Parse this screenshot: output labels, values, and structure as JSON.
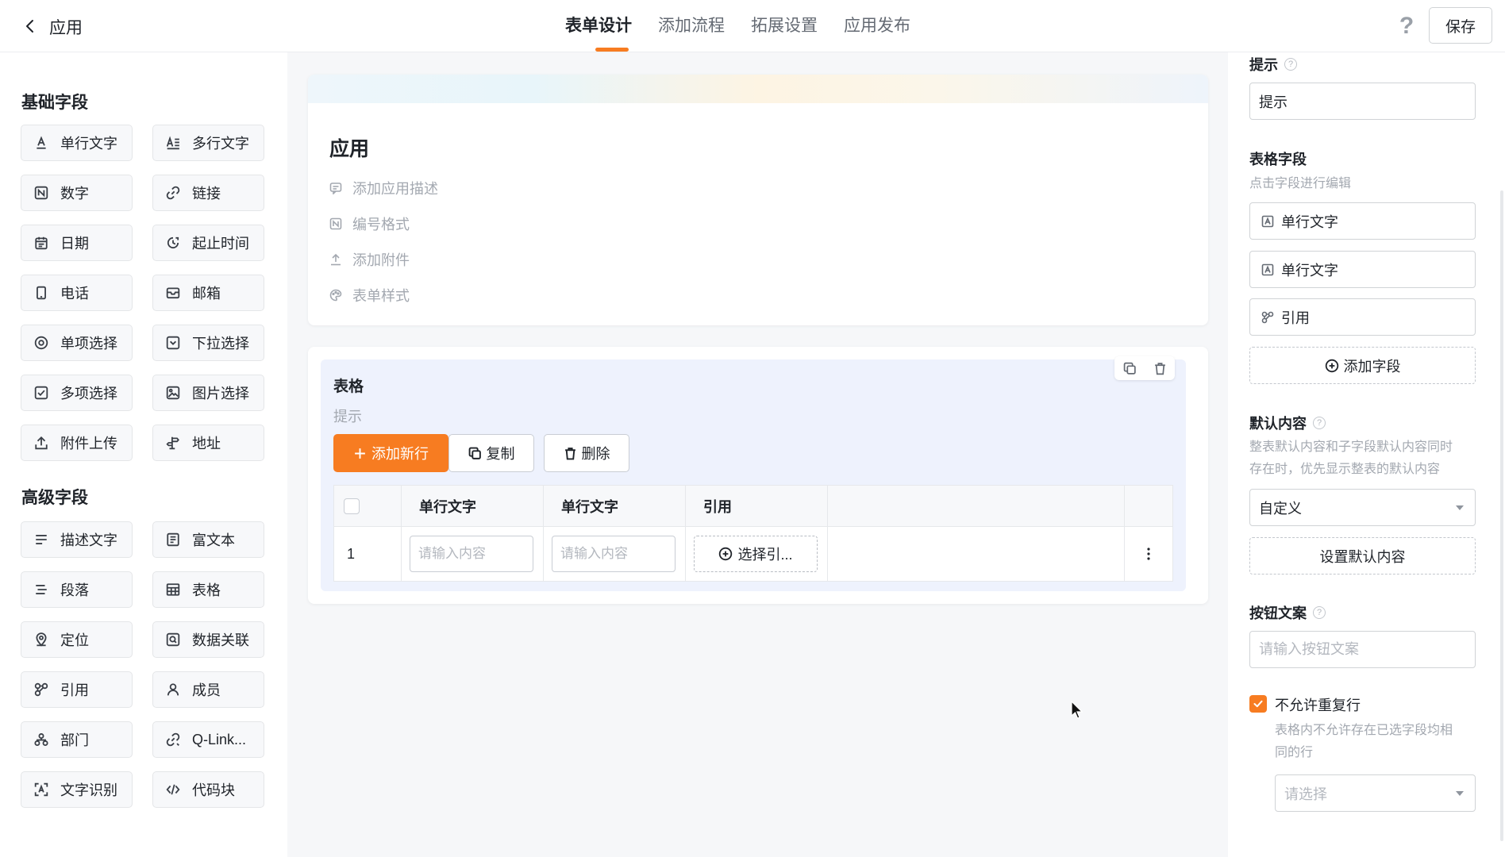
{
  "header": {
    "back_icon": "chevron-left-icon",
    "app_title": "应用",
    "tabs": [
      {
        "label": "表单设计",
        "active": true
      },
      {
        "label": "添加流程",
        "active": false
      },
      {
        "label": "拓展设置",
        "active": false
      },
      {
        "label": "应用发布",
        "active": false
      }
    ],
    "help_icon": "question-icon",
    "save_label": "保存",
    "accent_color": "#f77c21"
  },
  "left_panel": {
    "basic_title": "基础字段",
    "basic_fields": [
      {
        "label": "单行文字",
        "icon": "text-icon"
      },
      {
        "label": "多行文字",
        "icon": "multiline-text-icon"
      },
      {
        "label": "数字",
        "icon": "number-icon"
      },
      {
        "label": "链接",
        "icon": "link-icon"
      },
      {
        "label": "日期",
        "icon": "calendar-icon"
      },
      {
        "label": "起止时间",
        "icon": "time-range-icon"
      },
      {
        "label": "电话",
        "icon": "phone-icon"
      },
      {
        "label": "邮箱",
        "icon": "mail-icon"
      },
      {
        "label": "单项选择",
        "icon": "radio-icon"
      },
      {
        "label": "下拉选择",
        "icon": "dropdown-icon"
      },
      {
        "label": "多项选择",
        "icon": "checkbox-icon"
      },
      {
        "label": "图片选择",
        "icon": "image-icon"
      },
      {
        "label": "附件上传",
        "icon": "upload-icon"
      },
      {
        "label": "地址",
        "icon": "signpost-icon"
      }
    ],
    "advanced_title": "高级字段",
    "advanced_fields": [
      {
        "label": "描述文字",
        "icon": "description-icon"
      },
      {
        "label": "富文本",
        "icon": "rich-text-icon"
      },
      {
        "label": "段落",
        "icon": "paragraph-icon"
      },
      {
        "label": "表格",
        "icon": "table-icon"
      },
      {
        "label": "定位",
        "icon": "location-icon"
      },
      {
        "label": "数据关联",
        "icon": "data-link-icon"
      },
      {
        "label": "引用",
        "icon": "reference-icon"
      },
      {
        "label": "成员",
        "icon": "user-icon"
      },
      {
        "label": "部门",
        "icon": "department-icon"
      },
      {
        "label": "Q-Link...",
        "icon": "qlink-icon"
      },
      {
        "label": "文字识别",
        "icon": "ocr-icon"
      },
      {
        "label": "代码块",
        "icon": "code-icon"
      }
    ]
  },
  "canvas": {
    "form_title": "应用",
    "options": [
      {
        "label": "添加应用描述",
        "icon": "comment-icon"
      },
      {
        "label": "编号格式",
        "icon": "number-format-icon"
      },
      {
        "label": "添加附件",
        "icon": "upload-icon"
      },
      {
        "label": "表单样式",
        "icon": "palette-icon"
      }
    ],
    "table": {
      "title": "表格",
      "hint": "提示",
      "add_row_label": "添加新行",
      "copy_label": "复制",
      "delete_label": "删除",
      "columns": [
        "单行文字",
        "单行文字",
        "引用"
      ],
      "row_number": "1",
      "input_placeholder": "请输入内容",
      "select_ref_label": "选择引..."
    }
  },
  "right_panel": {
    "hint_label": "提示",
    "hint_value": "提示",
    "table_fields_label": "表格字段",
    "table_fields_sub": "点击字段进行编辑",
    "table_fields": [
      {
        "label": "单行文字",
        "icon": "text-icon"
      },
      {
        "label": "单行文字",
        "icon": "text-icon"
      },
      {
        "label": "引用",
        "icon": "reference-icon"
      }
    ],
    "add_field_label": "添加字段",
    "default_label": "默认内容",
    "default_sub_1": "整表默认内容和子字段默认内容同时",
    "default_sub_2": "存在时，优先显示整表的默认内容",
    "default_select": "自定义",
    "set_default_label": "设置默认内容",
    "button_text_label": "按钮文案",
    "button_text_placeholder": "请输入按钮文案",
    "no_dup_label": "不允许重复行",
    "no_dup_checked": true,
    "no_dup_sub_1": "表格内不允许存在已选字段均相",
    "no_dup_sub_2": "同的行",
    "no_dup_select_placeholder": "请选择"
  }
}
